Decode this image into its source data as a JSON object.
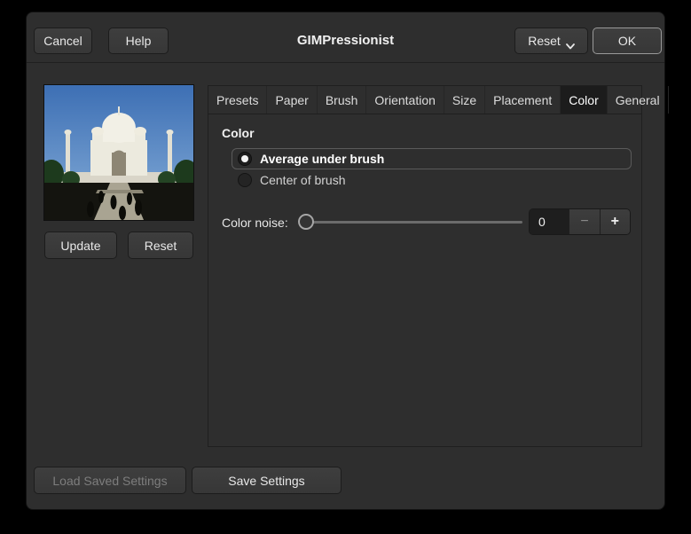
{
  "titlebar": {
    "title": "GIMPressionist",
    "cancel_label": "Cancel",
    "help_label": "Help",
    "reset_label": "Reset",
    "ok_label": "OK"
  },
  "preview": {
    "update_label": "Update",
    "reset_label": "Reset"
  },
  "tabs": [
    "Presets",
    "Paper",
    "Brush",
    "Orientation",
    "Size",
    "Placement",
    "Color",
    "General"
  ],
  "active_tab": "Color",
  "color_panel": {
    "section_title": "Color",
    "options": [
      {
        "label": "Average under brush",
        "selected": true
      },
      {
        "label": "Center of brush",
        "selected": false
      }
    ],
    "noise_label": "Color noise:",
    "noise_value": "0",
    "minus_icon": "−",
    "plus_icon": "+"
  },
  "footer": {
    "load_label": "Load Saved Settings",
    "save_label": "Save Settings"
  },
  "colors": {
    "window_bg": "#2e2e2e",
    "button_bg": "#3a3a3a",
    "active_tab_bg": "#1c1c1c",
    "panel_border": "#1f1f1f",
    "text": "#e8e8e8",
    "disabled_text": "#7d7d7d",
    "sky_blue": "#4e82c4"
  }
}
